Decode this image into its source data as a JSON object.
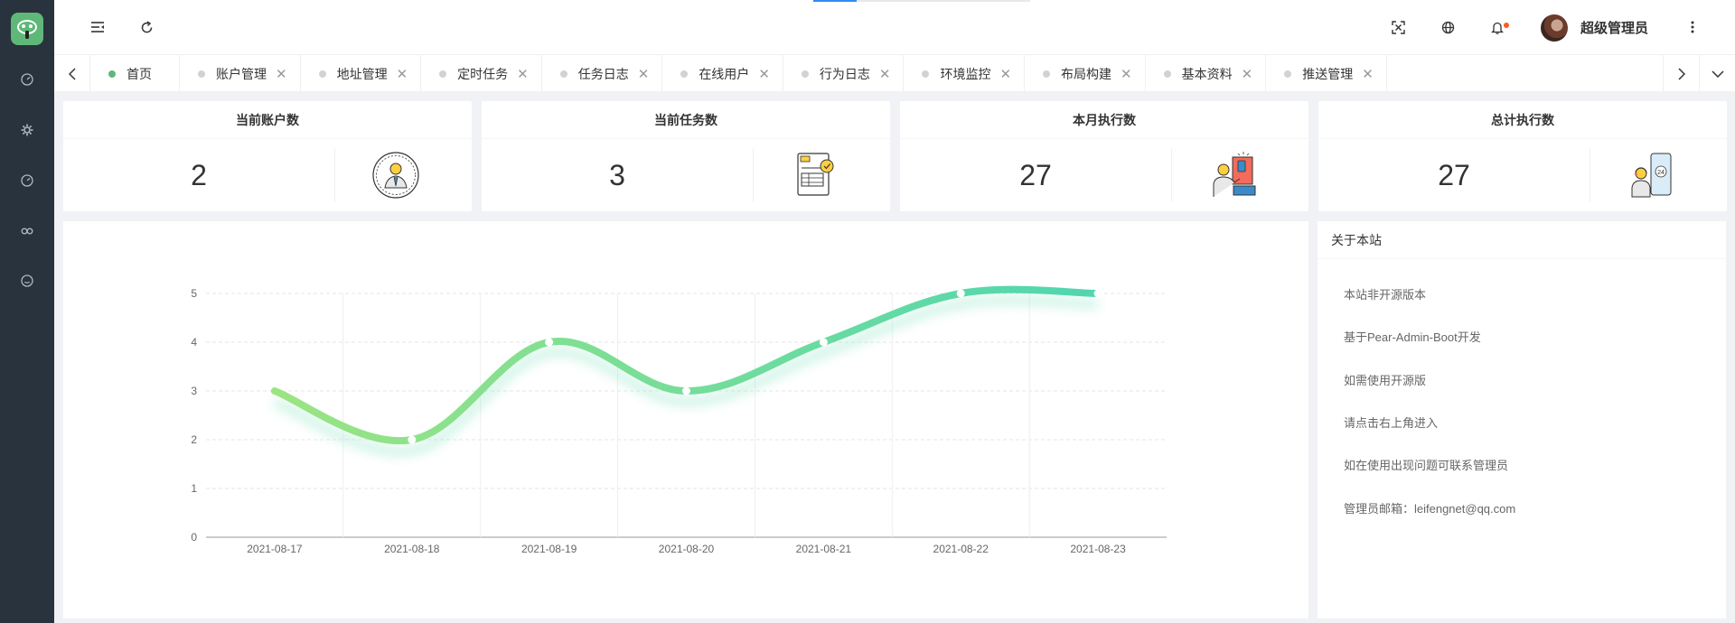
{
  "header": {
    "username": "超级管理员"
  },
  "tabs": [
    {
      "label": "首页",
      "active": true
    },
    {
      "label": "账户管理"
    },
    {
      "label": "地址管理"
    },
    {
      "label": "定时任务"
    },
    {
      "label": "任务日志"
    },
    {
      "label": "在线用户"
    },
    {
      "label": "行为日志"
    },
    {
      "label": "环境监控"
    },
    {
      "label": "布局构建"
    },
    {
      "label": "基本资料"
    },
    {
      "label": "推送管理"
    }
  ],
  "tab_close_glyph": "✕",
  "cards": [
    {
      "title": "当前账户数",
      "value": "2",
      "icon": "user-avatar-icon"
    },
    {
      "title": "当前任务数",
      "value": "3",
      "icon": "invoice-icon"
    },
    {
      "title": "本月执行数",
      "value": "27",
      "icon": "worker-icon"
    },
    {
      "title": "总计执行数",
      "value": "27",
      "icon": "phone-support-icon"
    }
  ],
  "about": {
    "title": "关于本站",
    "items": [
      "本站非开源版本",
      "基于Pear-Admin-Boot开发",
      "如需使用开源版",
      "请点击右上角进入",
      "如在使用出现问题可联系管理员",
      "管理员邮箱：leifengnet@qq.com"
    ]
  },
  "colors": {
    "sidebar": "#28333e",
    "accent": "#5fb878",
    "line_start": "#9be482",
    "line_end": "#4fd6b0"
  },
  "chart_data": {
    "type": "line",
    "x": [
      "2021-08-17",
      "2021-08-18",
      "2021-08-19",
      "2021-08-20",
      "2021-08-21",
      "2021-08-22",
      "2021-08-23"
    ],
    "values": [
      3,
      2,
      4,
      3,
      4,
      5,
      5
    ],
    "ylim": [
      0,
      5
    ],
    "yticks": [
      0,
      1,
      2,
      3,
      4,
      5
    ],
    "smooth": true,
    "grid": true
  }
}
